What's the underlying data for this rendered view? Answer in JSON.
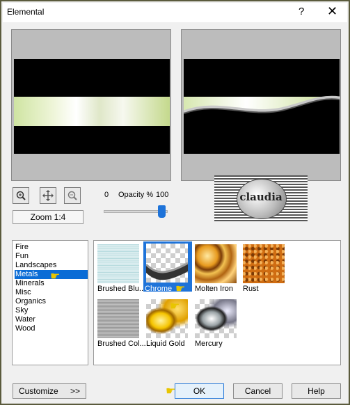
{
  "window": {
    "title": "Elemental",
    "help_glyph": "?",
    "close_glyph": "✕"
  },
  "toolbar": {
    "zoom_in_icon": "magnifier-plus",
    "pan_icon": "move-cross",
    "zoom_out_icon": "magnifier-minus"
  },
  "zoom": {
    "label": "Zoom 1:4"
  },
  "opacity": {
    "min": "0",
    "label": "Opacity %",
    "max": "100",
    "value_percent": 100
  },
  "logo": {
    "text": "claudia"
  },
  "categories": {
    "items": [
      "Fire",
      "Fun",
      "Landscapes",
      "Metals",
      "Minerals",
      "Misc",
      "Organics",
      "Sky",
      "Water",
      "Wood"
    ],
    "selected": "Metals"
  },
  "gallery": {
    "items": [
      {
        "label": "Brushed Blu...",
        "kind": "brushed-blue"
      },
      {
        "label": "Chrome",
        "kind": "chrome",
        "selected": true
      },
      {
        "label": "Molten Iron",
        "kind": "molten-iron"
      },
      {
        "label": "Rust",
        "kind": "rust"
      },
      {
        "label": "Brushed Col...",
        "kind": "brushed-col"
      },
      {
        "label": "Liquid Gold",
        "kind": "liquid-gold"
      },
      {
        "label": "Mercury",
        "kind": "mercury"
      }
    ]
  },
  "buttons": {
    "customize": "Customize",
    "customize_arrow": ">>",
    "ok": "OK",
    "cancel": "Cancel",
    "help": "Help"
  },
  "colors": {
    "accent": "#0a6cd6",
    "selected_thumb": "#1e73d9",
    "frame": "#5b5b3d"
  }
}
